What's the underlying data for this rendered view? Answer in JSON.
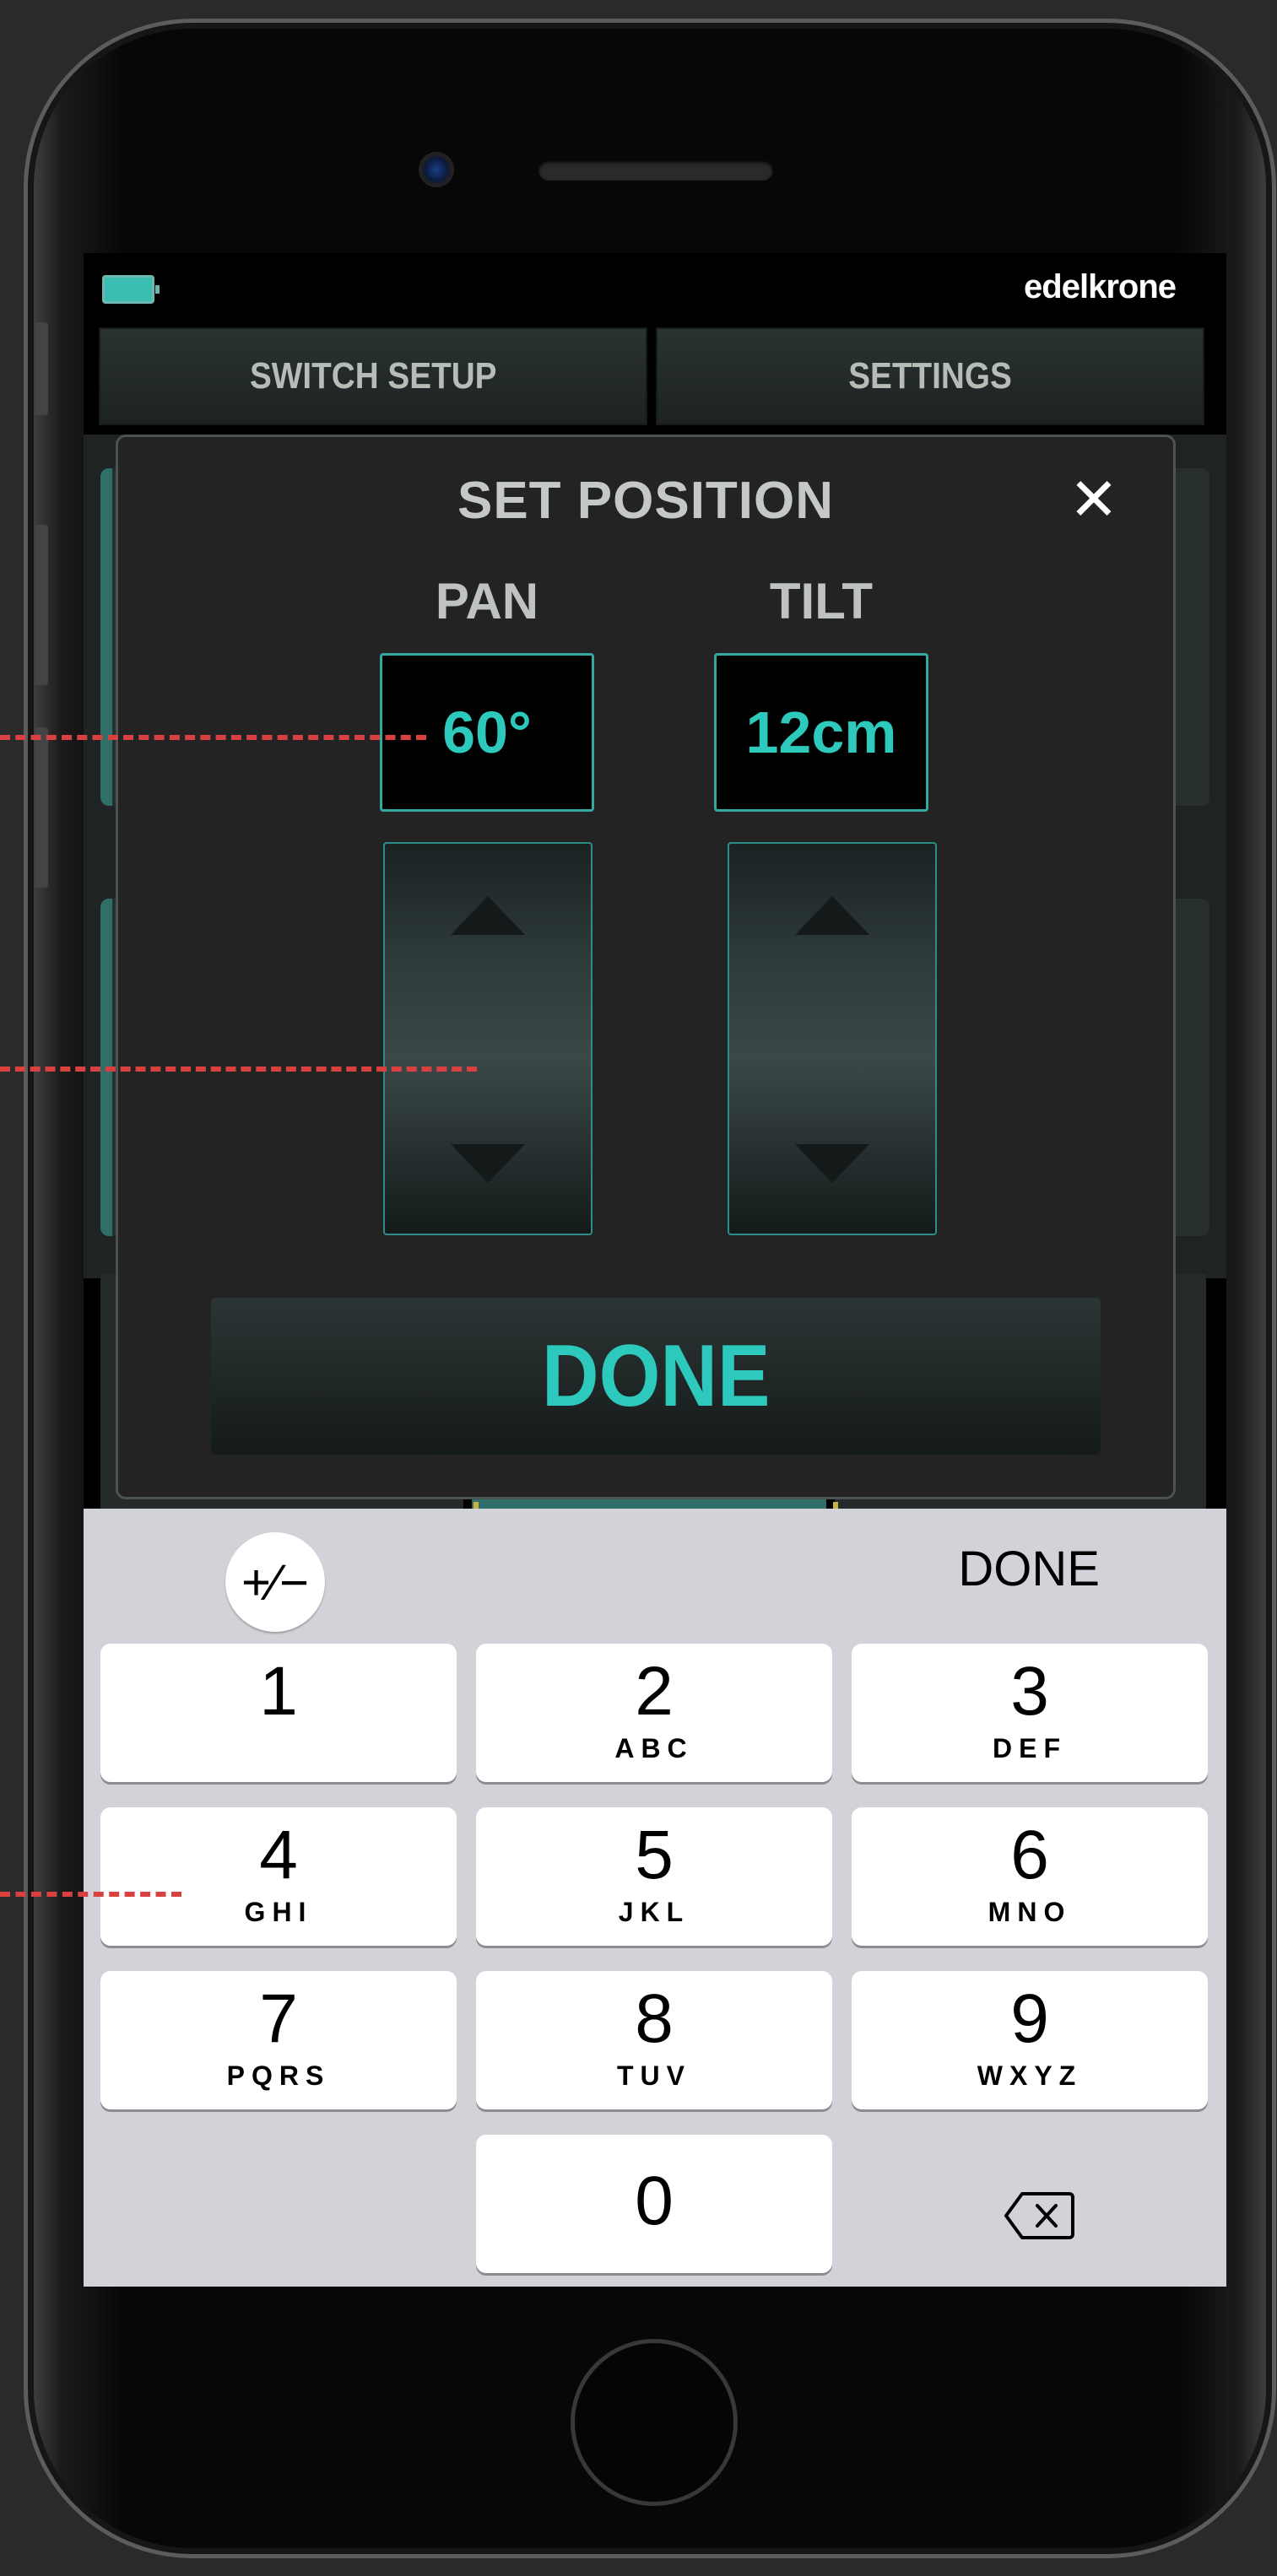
{
  "header": {
    "brand": "edelkrone",
    "tabs": [
      "SWITCH SETUP",
      "SETTINGS"
    ]
  },
  "modal": {
    "title": "SET POSITION",
    "close_symbol": "✕",
    "pan": {
      "label": "PAN",
      "value": "60°"
    },
    "tilt": {
      "label": "TILT",
      "value": "12cm"
    },
    "done_label": "DONE"
  },
  "keyboard": {
    "plus_minus": "+∕−",
    "done_label": "DONE",
    "keys": [
      {
        "num": "1",
        "letters": ""
      },
      {
        "num": "2",
        "letters": "ABC"
      },
      {
        "num": "3",
        "letters": "DEF"
      },
      {
        "num": "4",
        "letters": "GHI"
      },
      {
        "num": "5",
        "letters": "JKL"
      },
      {
        "num": "6",
        "letters": "MNO"
      },
      {
        "num": "7",
        "letters": "PQRS"
      },
      {
        "num": "8",
        "letters": "TUV"
      },
      {
        "num": "9",
        "letters": "WXYZ"
      },
      {
        "num": "0",
        "letters": ""
      }
    ]
  },
  "colors": {
    "accent": "#2ec9bd",
    "annotation_dash": "#d94141"
  },
  "icons": [
    "battery-icon",
    "close-icon",
    "arrow-up-icon",
    "arrow-down-icon",
    "backspace-icon",
    "plus-minus-icon"
  ]
}
